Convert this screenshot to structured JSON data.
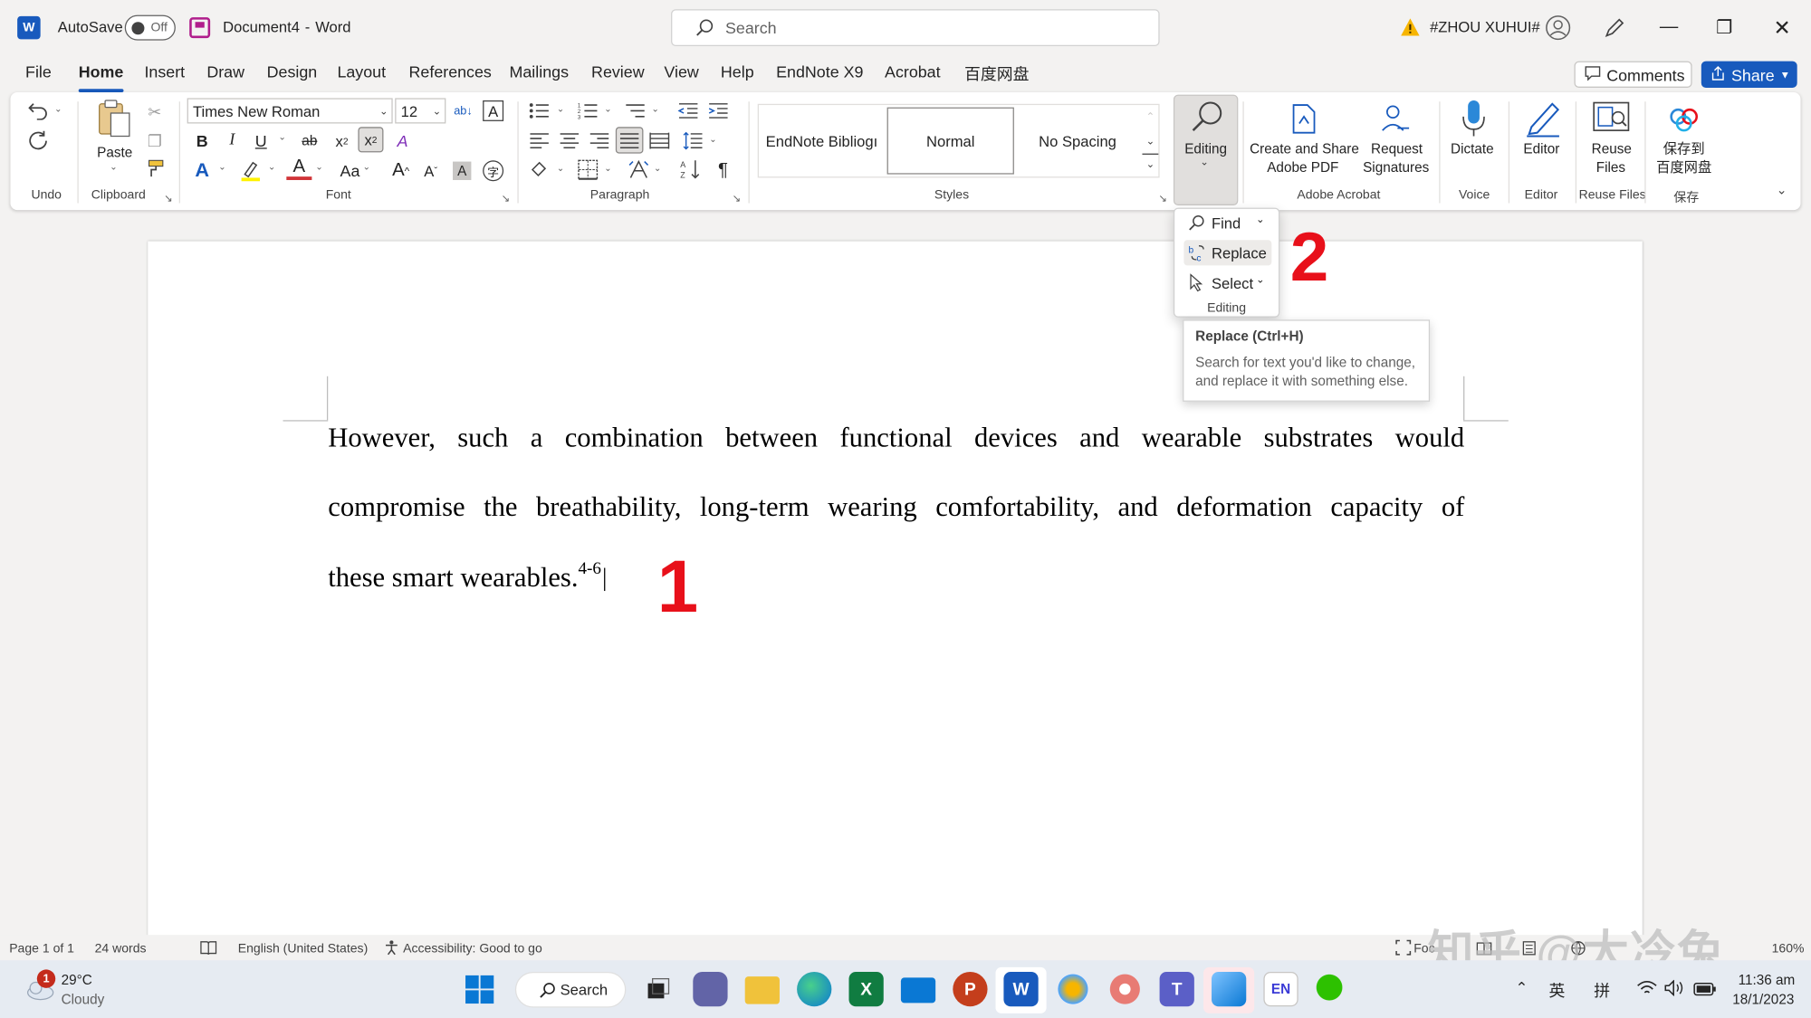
{
  "titlebar": {
    "autosave_label": "AutoSave",
    "autosave_state": "Off",
    "doc_title": "Document4",
    "separator": "-",
    "app_name": "Word",
    "search_placeholder": "Search",
    "user_name": "#ZHOU XUHUI#",
    "icons": [
      "word-app-icon",
      "save-icon",
      "search-icon",
      "warning-icon",
      "user-avatar-icon",
      "pen-icon",
      "minimize-icon",
      "restore-icon",
      "close-icon"
    ]
  },
  "menu": {
    "items": [
      "File",
      "Home",
      "Insert",
      "Draw",
      "Design",
      "Layout",
      "References",
      "Mailings",
      "Review",
      "View",
      "Help",
      "EndNote X9",
      "Acrobat",
      "百度网盘"
    ],
    "active": "Home",
    "comments_label": "Comments",
    "share_label": "Share",
    "accent_color": "#185abd"
  },
  "ribbon": {
    "undo_group": "Undo",
    "clipboard": {
      "group": "Clipboard",
      "paste": "Paste"
    },
    "font": {
      "group": "Font",
      "family": "Times New Roman",
      "size": "12",
      "bold": "B",
      "italic": "I",
      "underline": "U",
      "strike": "ab",
      "subscript": "x",
      "superscript": "x",
      "text_effect": "A",
      "font_color": "A",
      "change_case": "Aa",
      "grow": "A",
      "shrink": "A"
    },
    "paragraph": {
      "group": "Paragraph",
      "pilcrow": "¶"
    },
    "styles": {
      "group": "Styles",
      "items": [
        "EndNote Bibliogı",
        "Normal",
        "No Spacing"
      ],
      "selected": "Normal"
    },
    "editing": {
      "label": "Editing"
    },
    "acrobat": {
      "group": "Adobe Acrobat",
      "create_line1": "Create and Share",
      "create_line2": "Adobe PDF",
      "request_line1": "Request",
      "request_line2": "Signatures"
    },
    "voice": {
      "group": "Voice",
      "dictate": "Dictate"
    },
    "editor": {
      "group": "Editor",
      "label": "Editor"
    },
    "reuse": {
      "group": "Reuse Files",
      "line1": "Reuse",
      "line2": "Files"
    },
    "baidu": {
      "group": "保存",
      "line1": "保存到",
      "line2": "百度网盘"
    }
  },
  "editing_dropdown": {
    "find": "Find",
    "replace": "Replace",
    "select": "Select",
    "footer": "Editing"
  },
  "tooltip": {
    "title": "Replace (Ctrl+H)",
    "line1": "Search for text you'd like to change,",
    "line2": "and replace it with something else."
  },
  "document": {
    "line1_words": [
      "However,",
      "such",
      "a",
      "combination",
      "between",
      "functional",
      "devices",
      "and",
      "wearable",
      "substrates",
      "would"
    ],
    "line2_words": [
      "compromise",
      "the",
      "breathability,",
      "long-term",
      "wearing",
      "comfortability,",
      "and",
      "deformation",
      "capacity",
      "of"
    ],
    "line3_text": "these smart wearables.",
    "line3_superscript": "4-6"
  },
  "annotations": {
    "step1": "1",
    "step2": "2",
    "color": "#e8101a"
  },
  "statusbar": {
    "page": "Page 1 of 1",
    "words": "24 words",
    "language": "English (United States)",
    "accessibility": "Accessibility: Good to go",
    "focus": "Foc",
    "zoom": "160%",
    "watermark": "知乎 @大冷兔"
  },
  "taskbar": {
    "weather_badge": "1",
    "temperature": "29°C",
    "condition": "Cloudy",
    "search_label": "Search",
    "ime_lang": "英",
    "ime_mode": "拼",
    "time": "11:36 am",
    "date": "18/1/2023",
    "icons": [
      "windows-start-icon",
      "search-icon",
      "task-view-icon",
      "teams-chat-icon",
      "file-explorer-icon",
      "edge-icon",
      "excel-icon",
      "mail-icon",
      "powerpoint-icon",
      "word-icon",
      "app-icon",
      "chrome-like-icon",
      "teams-icon",
      "paint-icon",
      "en-keyboard-icon",
      "wechat-icon"
    ]
  }
}
